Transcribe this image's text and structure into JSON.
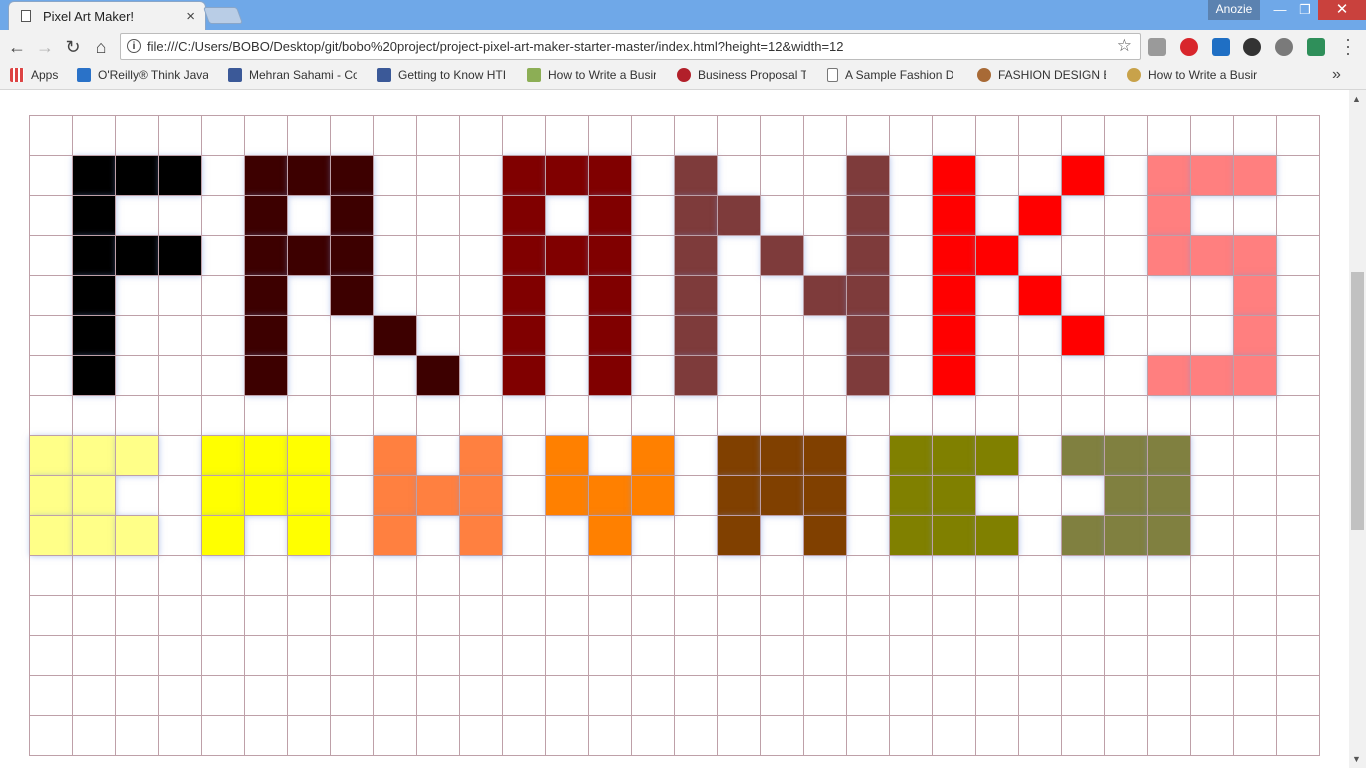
{
  "browser": {
    "tab_title": "Pixel Art Maker!",
    "tab_close": "×",
    "profile_name": "Anozie",
    "url": "file:///C:/Users/BOBO/Desktop/git/bobo%20project/project-pixel-art-maker-starter-master/index.html?height=12&width=12",
    "window_buttons": {
      "minimize": "—",
      "maximize": "❐",
      "close": "✕"
    },
    "nav": {
      "back": "←",
      "forward": "→",
      "reload": "↻",
      "home": "⌂",
      "star": "☆",
      "info": "i"
    }
  },
  "bookmarks": [
    {
      "label": "Apps",
      "icon": "apps-grid-icon",
      "color": "#d44"
    },
    {
      "label": "O'Reilly® Think Java",
      "icon": "oreilly-icon",
      "color": "#2a72c8"
    },
    {
      "label": "Mehran Sahami - Co",
      "icon": "facebook-icon",
      "color": "#3b5998"
    },
    {
      "label": "Getting to Know HTI",
      "icon": "facebook-icon",
      "color": "#3b5998"
    },
    {
      "label": "How to Write a Busir",
      "icon": "wikihow-icon",
      "color": "#8cae55"
    },
    {
      "label": "Business Proposal Te",
      "icon": "r-logo-icon",
      "color": "#b2202a"
    },
    {
      "label": "A Sample Fashion D",
      "icon": "page-icon",
      "color": "#ffffff"
    },
    {
      "label": "FASHION DESIGN BU",
      "icon": "avatar-icon",
      "color": "#a86a36"
    },
    {
      "label": "How to Write a Busir",
      "icon": "c-logo-icon",
      "color": "#c8a24a"
    }
  ],
  "bookmarks_overflow": "»",
  "grid": {
    "rows": 16,
    "cols": 30,
    "colors": {
      "black": "#000000",
      "darkmaroon": "#3d0000",
      "maroon": "#800000",
      "rosybrown": "#7e3b3b",
      "red": "#ff0000",
      "pink": "#ff7f7f",
      "lightyellow": "#ffff88",
      "yellow": "#ffff00",
      "coral": "#ff8040",
      "orange": "#ff8000",
      "brown": "#804000",
      "olive": "#808000",
      "khaki": "#808040"
    },
    "filled": {
      "black": [
        "1,1",
        "1,2",
        "1,3",
        "2,1",
        "3,1",
        "3,2",
        "3,3",
        "4,1",
        "5,1",
        "6,1"
      ],
      "darkmaroon": [
        "1,5",
        "1,6",
        "1,7",
        "2,5",
        "2,7",
        "3,5",
        "3,6",
        "3,7",
        "4,5",
        "4,7",
        "5,5",
        "5,8",
        "6,5",
        "6,9"
      ],
      "maroon": [
        "1,11",
        "1,12",
        "1,13",
        "2,11",
        "2,13",
        "3,11",
        "3,12",
        "3,13",
        "4,11",
        "4,13",
        "5,11",
        "5,13",
        "6,11",
        "6,13"
      ],
      "rosybrown": [
        "1,15",
        "1,19",
        "2,15",
        "2,16",
        "2,19",
        "3,15",
        "3,17",
        "3,19",
        "4,15",
        "4,18",
        "4,19",
        "5,15",
        "5,19",
        "6,15",
        "6,19"
      ],
      "red": [
        "1,21",
        "1,24",
        "2,21",
        "2,23",
        "3,21",
        "3,22",
        "4,21",
        "4,23",
        "5,21",
        "5,24",
        "6,21"
      ],
      "pink": [
        "1,26",
        "1,27",
        "1,28",
        "2,26",
        "3,26",
        "3,27",
        "3,28",
        "4,28",
        "5,28",
        "6,26",
        "6,27",
        "6,28"
      ],
      "lightyellow": [
        "8,0",
        "8,1",
        "8,2",
        "9,0",
        "9,1",
        "10,0",
        "10,1",
        "10,2"
      ],
      "yellow": [
        "8,4",
        "8,5",
        "8,6",
        "9,4",
        "9,5",
        "9,6",
        "10,4",
        "10,6"
      ],
      "coral": [
        "8,8",
        "8,10",
        "9,8",
        "9,9",
        "9,10",
        "10,8",
        "10,10"
      ],
      "orange": [
        "8,12",
        "8,14",
        "9,12",
        "9,13",
        "9,14",
        "10,13"
      ],
      "brown": [
        "8,16",
        "8,17",
        "8,18",
        "9,16",
        "9,17",
        "9,18",
        "10,16",
        "10,18"
      ],
      "olive": [
        "8,20",
        "8,21",
        "8,22",
        "9,20",
        "9,21",
        "10,20",
        "10,21",
        "10,22"
      ],
      "khaki": [
        "8,24",
        "8,25",
        "8,26",
        "9,25",
        "9,26",
        "10,24",
        "10,25",
        "10,26"
      ]
    }
  }
}
